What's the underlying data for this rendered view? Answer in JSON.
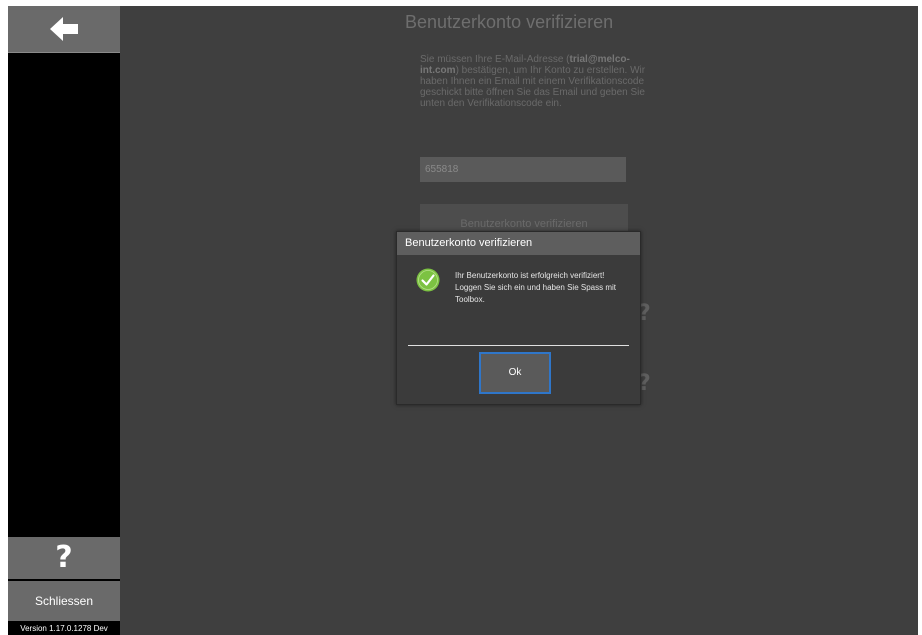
{
  "sidebar": {
    "back_icon": "arrow-left-icon",
    "help_label": "?",
    "close_label": "Schliessen",
    "version": "Version 1.17.0.1278 Dev"
  },
  "form": {
    "title": "Benutzerkonto verifizieren",
    "intro_before": "Sie müssen Ihre E-Mail-Adresse (",
    "intro_email": "trial@melco-int.com",
    "intro_after": ") bestätigen, um Ihr Konto zu erstellen. Wir haben Ihnen ein Email mit einem Verifikationscode geschickt bitte öffnen Sie das Email und geben Sie unten den Verifikationscode ein.",
    "code_value": "655818",
    "verify_label": "Benutzerkonto verifizieren",
    "help_mark_1": "?",
    "help_mark_2": "?"
  },
  "dialog": {
    "title": "Benutzerkonto verifizieren",
    "icon": "check-circle-icon",
    "message": "Ihr Benutzerkonto ist erfolgreich verifiziert! Loggen Sie sich ein und haben Sie Spass mit Toolbox.",
    "ok_label": "Ok"
  },
  "colors": {
    "background": "#3f3f3f",
    "sidebar": "#000000",
    "button": "#6a6a6a",
    "success": "#7cc242",
    "focus": "#2f76c9"
  }
}
